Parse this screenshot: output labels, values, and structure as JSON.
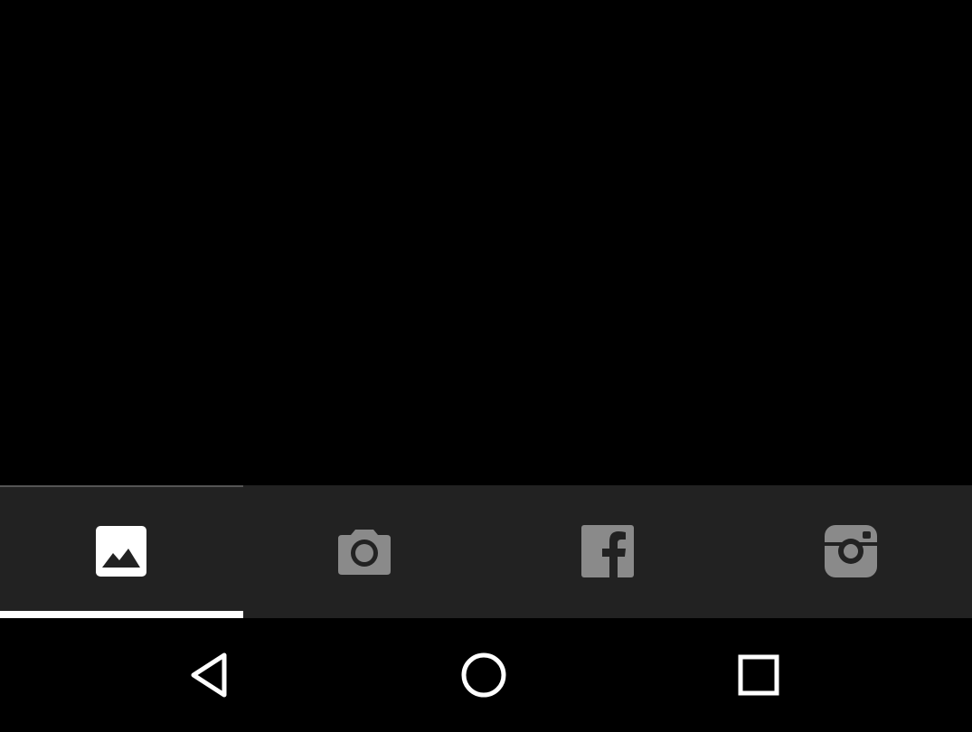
{
  "tabs": [
    {
      "icon": "image-icon",
      "selected": true
    },
    {
      "icon": "camera-icon",
      "selected": false
    },
    {
      "icon": "facebook-icon",
      "selected": false
    },
    {
      "icon": "instagram-icon",
      "selected": false
    }
  ],
  "nav_bar": {
    "buttons": [
      {
        "icon": "back-icon"
      },
      {
        "icon": "home-icon"
      },
      {
        "icon": "recents-icon"
      }
    ]
  },
  "colors": {
    "background": "#000000",
    "tab_bar": "#222222",
    "icon_selected": "#ffffff",
    "icon_unselected": "#8a8a8a",
    "indicator": "#ffffff",
    "nav_icon": "#ffffff"
  }
}
